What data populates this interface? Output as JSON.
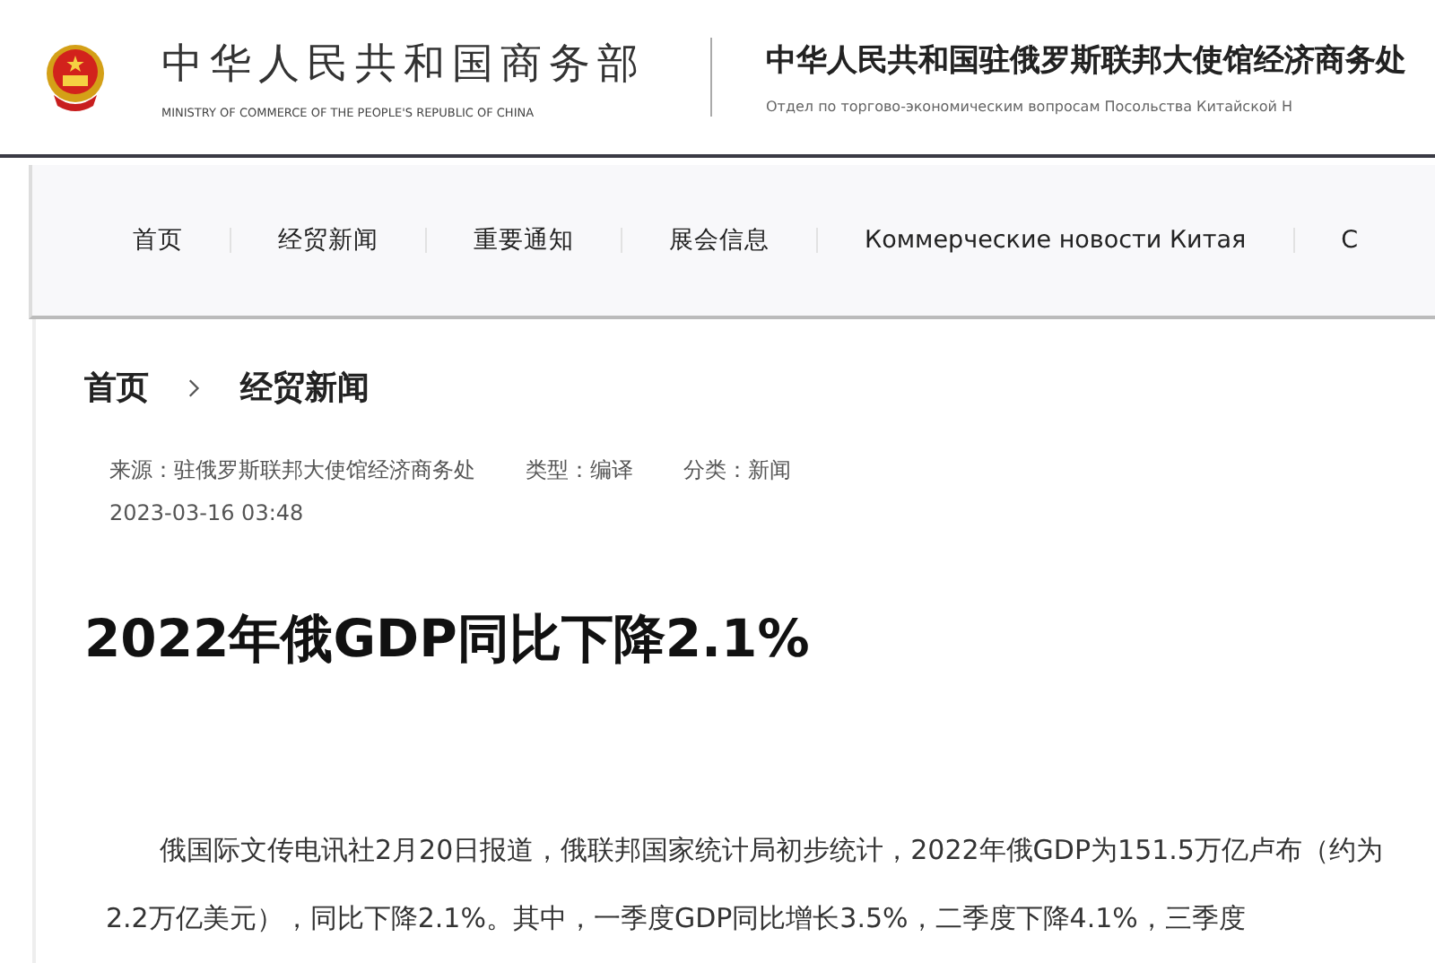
{
  "header": {
    "ministry_name": "中华人民共和国商务部",
    "ministry_name_en": "MINISTRY OF COMMERCE OF THE PEOPLE'S REPUBLIC OF CHINA",
    "office_name": "中华人民共和国驻俄罗斯联邦大使馆经济商务处",
    "office_name_ru": "Отдел по торгово-экономическим вопросам Посольства Китайской Н"
  },
  "nav": [
    {
      "label": "首页"
    },
    {
      "label": "经贸新闻"
    },
    {
      "label": "重要通知"
    },
    {
      "label": "展会信息"
    },
    {
      "label": "Коммерческие новости Китая"
    },
    {
      "label": "С"
    }
  ],
  "breadcrumb": [
    "首页",
    "经贸新闻"
  ],
  "meta": {
    "source": "来源：驻俄罗斯联邦大使馆经济商务处",
    "type": "类型：编译",
    "category": "分类：新闻",
    "date": "2023-03-16 03:48"
  },
  "article": {
    "title": "2022年俄GDP同比下降2.1%",
    "body": "俄国际文传电讯社2月20日报道，俄联邦国家统计局初步统计，2022年俄GDP为151.5万亿卢布（约为2.2万亿美元），同比下降2.1%。其中，一季度GDP同比增长3.5%，二季度下降4.1%，三季度"
  }
}
